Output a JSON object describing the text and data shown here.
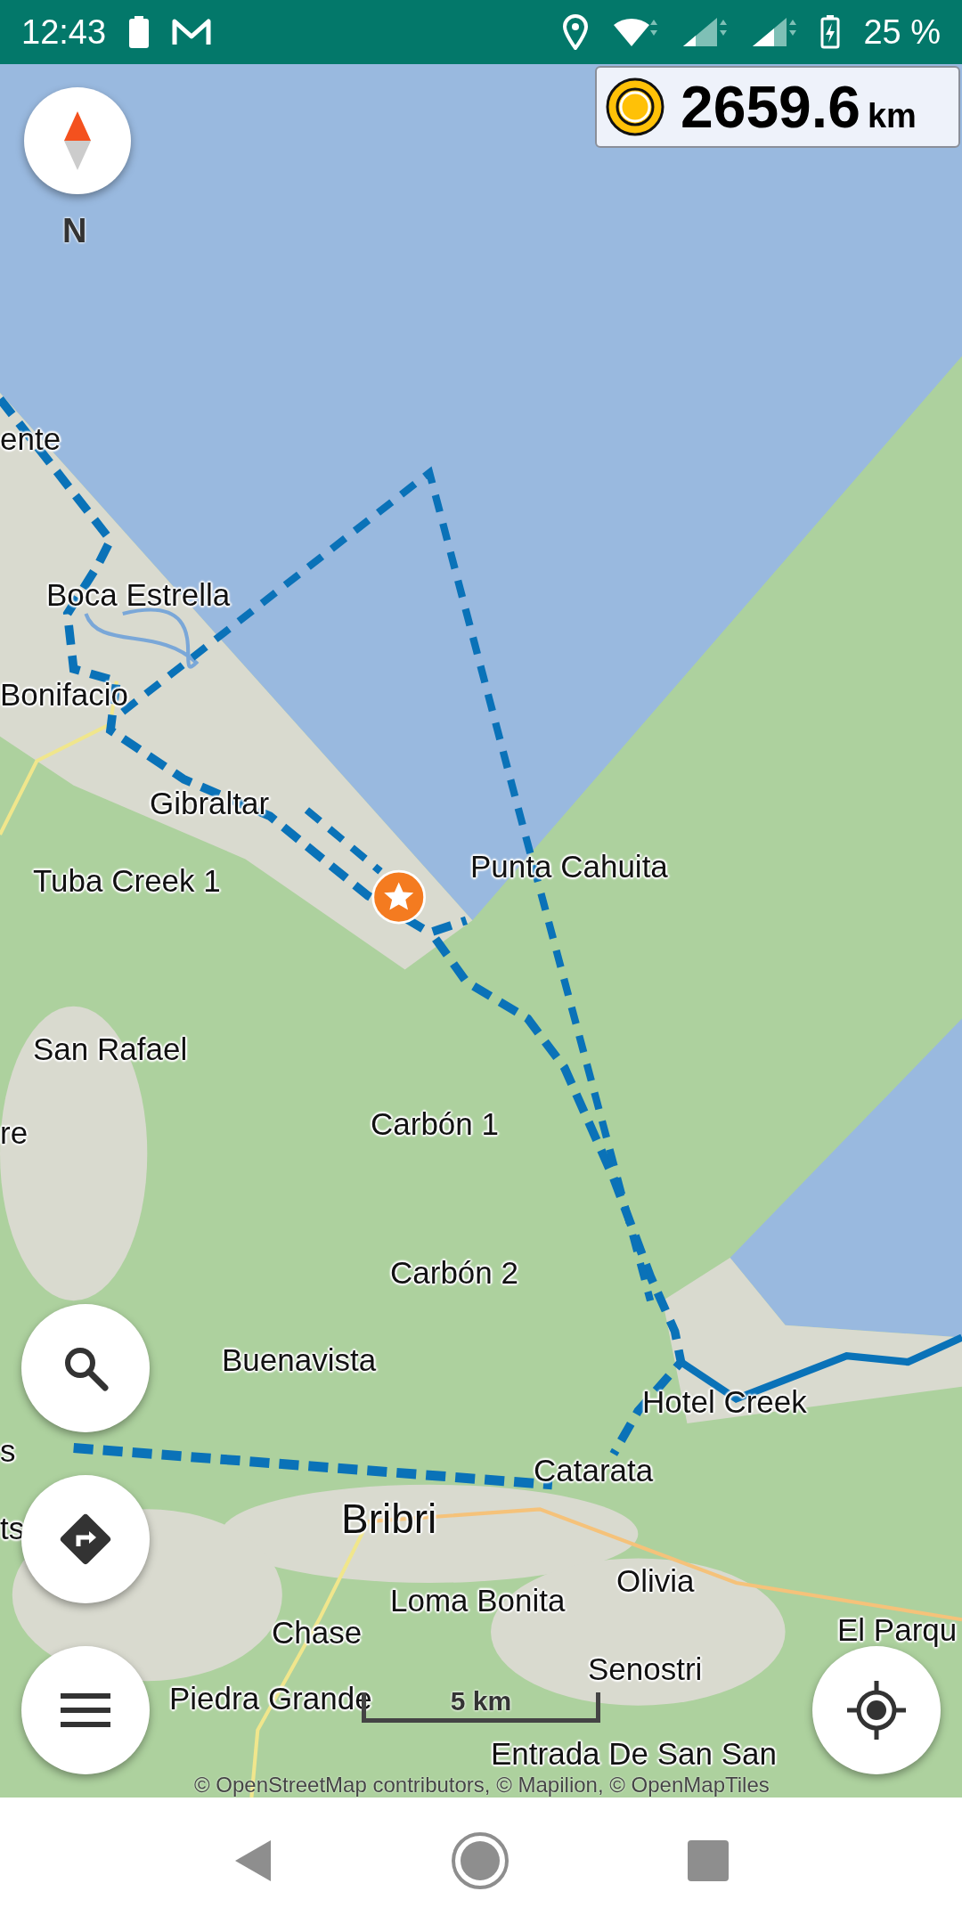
{
  "status_bar": {
    "time": "12:43",
    "battery": "25 %"
  },
  "distance": {
    "value": "2659.6",
    "unit": "km"
  },
  "compass": {
    "label": "N"
  },
  "map": {
    "labels": [
      {
        "text": "ente",
        "kind": "place"
      },
      {
        "text": "Boca Estrella",
        "kind": "place"
      },
      {
        "text": "Bonifacio",
        "kind": "place"
      },
      {
        "text": "Gibraltar",
        "kind": "place"
      },
      {
        "text": "Tuba Creek 1",
        "kind": "place"
      },
      {
        "text": "Punta Cahuita",
        "kind": "place"
      },
      {
        "text": "San Rafael",
        "kind": "place"
      },
      {
        "text": "re",
        "kind": "place"
      },
      {
        "text": "Carbón 1",
        "kind": "place"
      },
      {
        "text": "Carbón 2",
        "kind": "place"
      },
      {
        "text": "Buenavista",
        "kind": "place"
      },
      {
        "text": "Hotel Creek",
        "kind": "place"
      },
      {
        "text": "s",
        "kind": "place"
      },
      {
        "text": "Catarata",
        "kind": "place"
      },
      {
        "text": "ts",
        "kind": "place"
      },
      {
        "text": "Bribri",
        "kind": "town"
      },
      {
        "text": "Olivia",
        "kind": "place"
      },
      {
        "text": "Loma Bonita",
        "kind": "place"
      },
      {
        "text": "El Parqu",
        "kind": "place"
      },
      {
        "text": "Chase",
        "kind": "place"
      },
      {
        "text": "Senostri",
        "kind": "place"
      },
      {
        "text": "Piedra Grande",
        "kind": "place"
      },
      {
        "text": "Entrada De San San",
        "kind": "place"
      }
    ],
    "scale": "5 km",
    "attribution": "© OpenStreetMap contributors, © Mapilion, © OpenMapTiles"
  }
}
